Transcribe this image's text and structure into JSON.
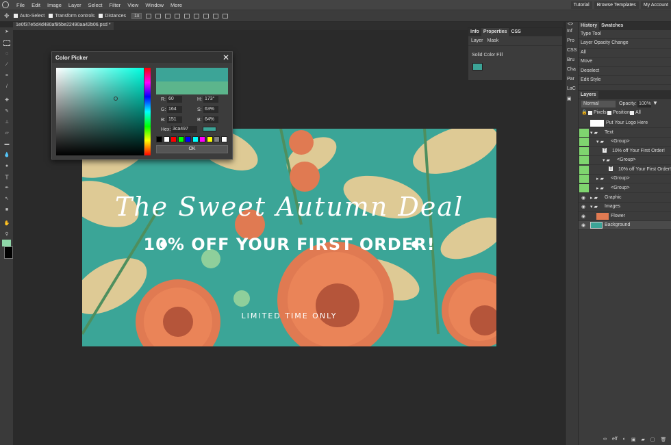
{
  "menu": [
    "File",
    "Edit",
    "Image",
    "Layer",
    "Select",
    "Filter",
    "View",
    "Window",
    "More"
  ],
  "menu_right": [
    "Tutorial",
    "Browse Templates",
    "My Account"
  ],
  "options": {
    "auto_select": "Auto-Select",
    "transform_controls": "Transform controls",
    "distances": "Distances",
    "zoom": "1x"
  },
  "document_tab": "1e0f37e5d4d480af95be22490aa42b06.psd *",
  "canvas": {
    "title": "The Sweet Autumn Deal",
    "offer": "10% OFF YOUR FIRST ORDER!",
    "subline": "LIMITED TIME ONLY"
  },
  "color_picker": {
    "title": "Color Picker",
    "close": "✕",
    "r_label": "R:",
    "r": "60",
    "g_label": "G:",
    "g": "164",
    "b_label": "B:",
    "b": "151",
    "h_label": "H:",
    "h": "173°",
    "s_label": "S:",
    "s": "63%",
    "v_label": "B:",
    "v": "64%",
    "hex_label": "Hex:",
    "hex": "3ca497",
    "ok": "OK",
    "current_color": "#3ca497",
    "previous_color": "#5cb58c",
    "swatches": [
      "#000000",
      "#ffffff",
      "#ff0000",
      "#00ff00",
      "#0000ff",
      "#00ffff",
      "#ff00ff",
      "#ffff00",
      "#808080",
      "#ffffff"
    ]
  },
  "properties": {
    "tabs": [
      "Info",
      "Properties",
      "CSS"
    ],
    "subtabs": [
      "Layer",
      "Mask"
    ],
    "fill_label": "Solid Color Fill",
    "fill_color": "#3ca497"
  },
  "panel_strip": [
    "Inf",
    "Pro",
    "CSS",
    "Bru",
    "Cha",
    "Par",
    "LaC"
  ],
  "history": {
    "tabs": [
      "History",
      "Swatches"
    ],
    "items": [
      "Type Tool",
      "Layer Opacity Change",
      "All",
      "Move",
      "Deselect",
      "Edit Style"
    ]
  },
  "layers": {
    "title": "Layers",
    "blend": "Normal",
    "opacity_label": "Opacity:",
    "opacity": "100%",
    "lock_label": "Pixels",
    "lock_position": "Position",
    "lock_all": "All",
    "rows": [
      "Put Your Logo Here",
      "Text",
      "<Group>",
      "10% off Your First Order!",
      "<Group>",
      "10% off Your First Order!",
      "<Group>",
      "<Group>",
      "Graphic",
      "Images",
      "Flower",
      "Background"
    ]
  }
}
